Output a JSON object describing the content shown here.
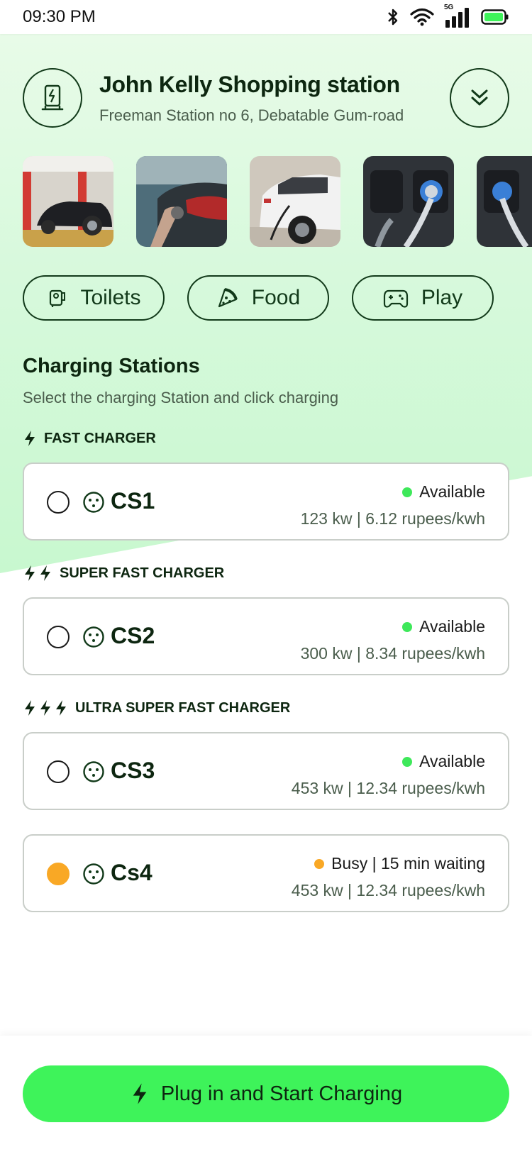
{
  "status_bar": {
    "time": "09:30 PM",
    "network_label": "5G"
  },
  "station": {
    "name": "John Kelly Shopping station",
    "address": "Freeman Station no 6, Debatable Gum-road"
  },
  "photos": [
    {
      "label": "parking-garage-car"
    },
    {
      "label": "car-charging-port"
    },
    {
      "label": "white-suv-charging"
    },
    {
      "label": "charging-plug-closeup"
    },
    {
      "label": "charging-plug-closeup-2"
    }
  ],
  "amenities": [
    {
      "label": "Toilets",
      "icon": "toilet-paper-icon"
    },
    {
      "label": "Food",
      "icon": "pizza-icon"
    },
    {
      "label": "Play",
      "icon": "gamepad-icon"
    }
  ],
  "section": {
    "title": "Charging Stations",
    "subtitle": "Select the charging Station and click charging"
  },
  "groups": [
    {
      "label": "FAST CHARGER",
      "bolts": 1
    },
    {
      "label": "SUPER FAST CHARGER",
      "bolts": 2
    },
    {
      "label": "ULTRA SUPER FAST CHARGER",
      "bolts": 3
    }
  ],
  "stations": [
    {
      "name": "CS1",
      "status": "Available",
      "status_color": "#3ee85a",
      "spec": "123 kw | 6.12 rupees/kwh",
      "selected": false
    },
    {
      "name": "CS2",
      "status": "Available",
      "status_color": "#3ee85a",
      "spec": "300 kw | 8.34 rupees/kwh",
      "selected": false
    },
    {
      "name": "CS3",
      "status": "Available",
      "status_color": "#3ee85a",
      "spec": "453 kw | 12.34 rupees/kwh",
      "selected": false
    },
    {
      "name": "Cs4",
      "status": "Busy | 15 min waiting",
      "status_color": "#f9a825",
      "spec": "453 kw | 12.34 rupees/kwh",
      "selected": true
    }
  ],
  "cta": {
    "label": "Plug in and Start Charging"
  },
  "colors": {
    "accent": "#3ef35a",
    "dark": "#0d2610",
    "busy": "#f9a825",
    "available": "#3ee85a"
  }
}
